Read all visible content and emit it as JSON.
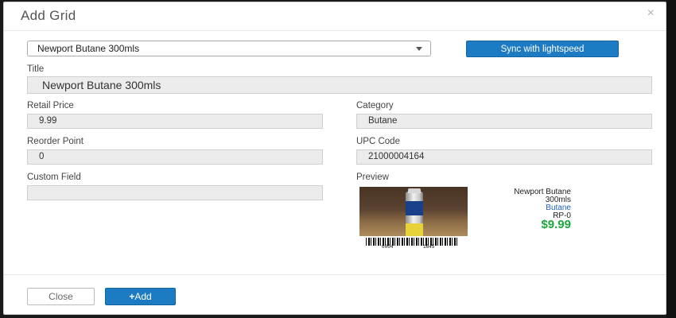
{
  "dialog": {
    "title": "Add Grid",
    "close_glyph": "×"
  },
  "product_select": {
    "value": "Newport Butane 300mls"
  },
  "sync_button": {
    "label": "Sync with lightspeed"
  },
  "form": {
    "title_label": "Title",
    "title_value": "Newport Butane 300mls",
    "retail_price_label": "Retail Price",
    "retail_price_value": "9.99",
    "category_label": "Category",
    "category_value": "Butane",
    "reorder_point_label": "Reorder Point",
    "reorder_point_value": "0",
    "upc_code_label": "UPC Code",
    "upc_code_value": "21000004164",
    "custom_field_label": "Custom Field",
    "custom_field_value": "",
    "preview_label": "Preview"
  },
  "preview": {
    "name_line1": "Newport Butane",
    "name_line2": "300mls",
    "category": "Butane",
    "reorder": "RP-0",
    "price": "$9.99",
    "barcode_left": "0004",
    "barcode_right": "1645",
    "category_color": "#1d5fc4",
    "price_color": "#1aa83a"
  },
  "footer": {
    "close_label": "Close",
    "add_label": "Add",
    "add_icon": "+"
  },
  "colors": {
    "primary": "#1d7bc4",
    "field_bg": "#ececec"
  }
}
